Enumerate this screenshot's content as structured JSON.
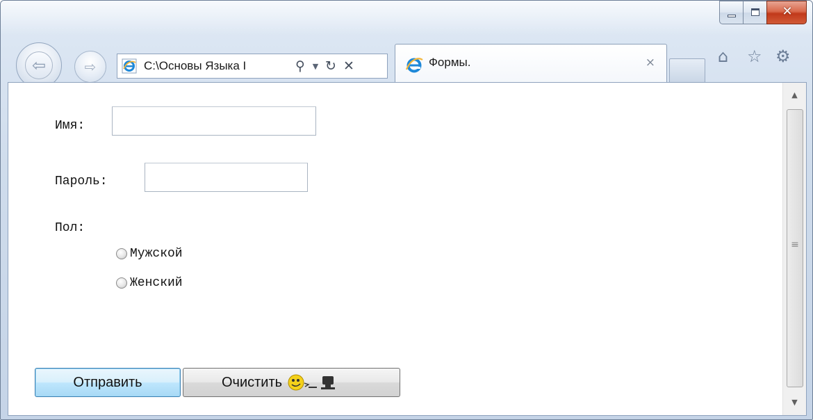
{
  "window": {
    "caption_buttons": {
      "minimize_icon": "minimize-icon",
      "maximize_icon": "maximize-icon",
      "close_glyph": "✕"
    }
  },
  "toolbar": {
    "back_glyph": "⇦",
    "forward_glyph": "⇨",
    "address_text": "C:\\Основы Языка I",
    "search_glyph": "⚲",
    "dropdown_glyph": "▼",
    "refresh_glyph": "↻",
    "stop_glyph": "✕"
  },
  "tab": {
    "title": "Формы.",
    "close_glyph": "×"
  },
  "commands": {
    "home_glyph": "⌂",
    "favorites_glyph": "☆",
    "tools_glyph": "⚙"
  },
  "form": {
    "name_label": "Имя:",
    "password_label": "Пароль:",
    "gender_label": "Пол:",
    "gender_options": [
      "Мужской",
      "Женский"
    ],
    "submit_label": "Отправить",
    "reset_label": "Очистить"
  },
  "scrollbar": {
    "up_glyph": "▲",
    "down_glyph": "▼",
    "grip_glyph": "≡"
  },
  "colors": {
    "ie_logo": "#1e88d8",
    "submit_border": "#3c7fb1",
    "close_button": "#c1391a"
  }
}
